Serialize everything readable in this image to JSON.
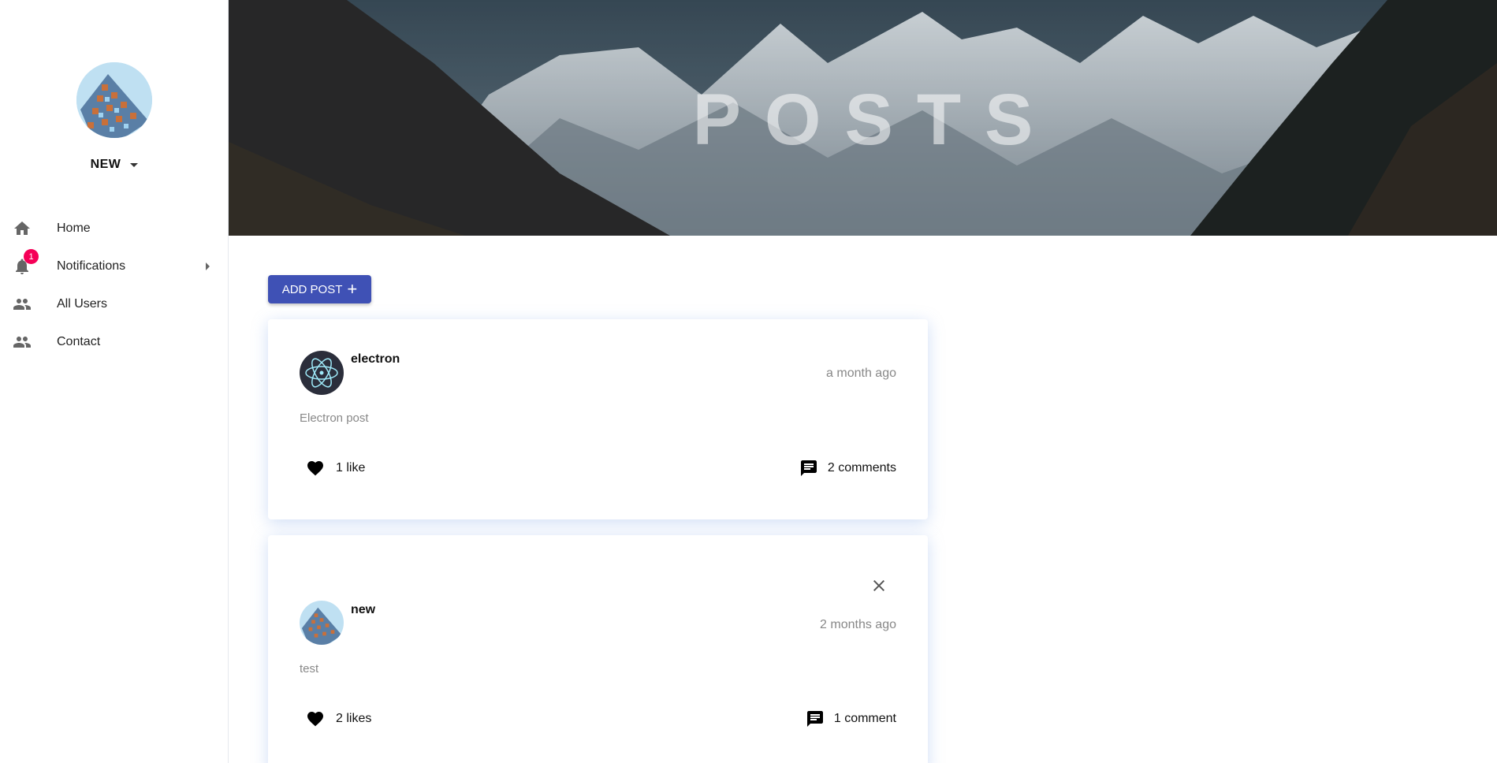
{
  "user": {
    "name": "NEW"
  },
  "nav": [
    {
      "label": "Home",
      "icon": "home-icon"
    },
    {
      "label": "Notifications",
      "icon": "bell-icon",
      "badge": "1"
    },
    {
      "label": "All Users",
      "icon": "people-icon"
    },
    {
      "label": "Contact",
      "icon": "people-icon"
    }
  ],
  "hero": {
    "title": "POSTS"
  },
  "add_button": {
    "label": "ADD POST"
  },
  "posts": [
    {
      "author": "electron",
      "time": "a month ago",
      "body": "Electron post",
      "likes": "1 like",
      "comments": "2 comments"
    },
    {
      "author": "new",
      "time": "2 months ago",
      "body": "test",
      "likes": "2 likes",
      "comments": "1 comment"
    }
  ],
  "colors": {
    "primary": "#3f51b5",
    "badge": "#f50057",
    "muted_text": "#888888"
  }
}
